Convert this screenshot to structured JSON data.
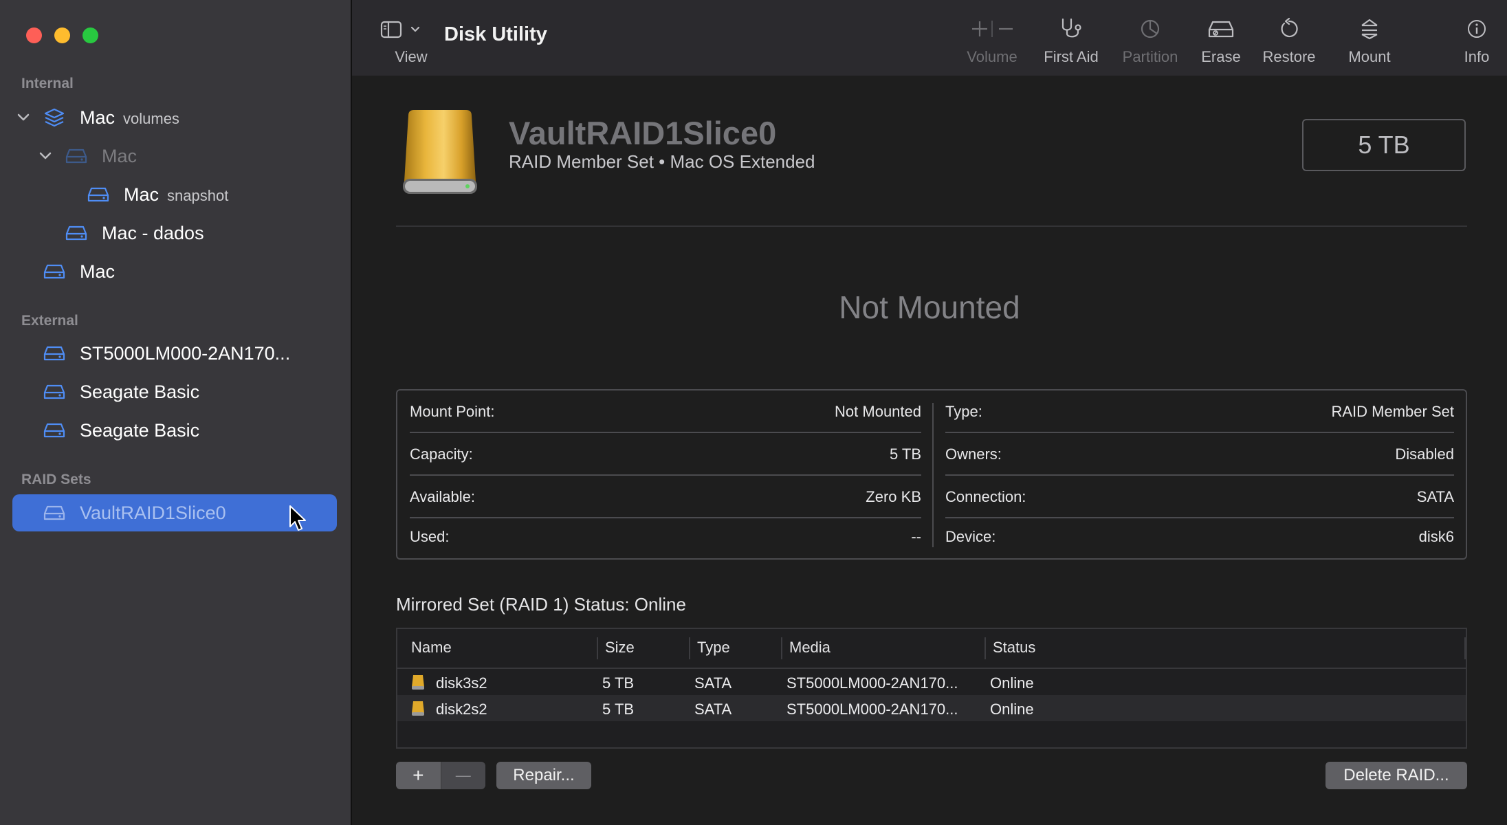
{
  "window": {
    "title": "Disk Utility",
    "view_label": "View"
  },
  "toolbar": {
    "volume_label": "Volume",
    "first_aid_label": "First Aid",
    "partition_label": "Partition",
    "erase_label": "Erase",
    "restore_label": "Restore",
    "mount_label": "Mount",
    "info_label": "Info"
  },
  "sidebar": {
    "internal_header": "Internal",
    "external_header": "External",
    "raid_header": "RAID Sets",
    "items": [
      {
        "label": "Mac",
        "sub": "volumes",
        "icon": "layers-icon",
        "level": 0,
        "expanded": true
      },
      {
        "label": "Mac",
        "sub": "",
        "icon": "disk-icon",
        "level": 1,
        "expanded": true,
        "dimmed": true
      },
      {
        "label": "Mac",
        "sub": "snapshot",
        "icon": "disk-icon",
        "level": 2
      },
      {
        "label": "Mac - dados",
        "sub": "",
        "icon": "disk-icon",
        "level": 1
      },
      {
        "label": "Mac",
        "sub": "",
        "icon": "disk-icon",
        "level": 0
      }
    ],
    "external_items": [
      {
        "label": "ST5000LM000-2AN170...",
        "icon": "disk-icon"
      },
      {
        "label": "Seagate Basic",
        "icon": "disk-icon"
      },
      {
        "label": "Seagate Basic",
        "icon": "disk-icon"
      }
    ],
    "raid_items": [
      {
        "label": "VaultRAID1Slice0",
        "icon": "disk-icon",
        "selected": true
      }
    ]
  },
  "volume": {
    "name": "VaultRAID1Slice0",
    "subtitle": "RAID Member Set • Mac OS Extended",
    "capacity_badge": "5 TB",
    "state_text": "Not Mounted"
  },
  "info": {
    "left": [
      {
        "key": "Mount Point:",
        "value": "Not Mounted"
      },
      {
        "key": "Capacity:",
        "value": "5 TB"
      },
      {
        "key": "Available:",
        "value": "Zero KB"
      },
      {
        "key": "Used:",
        "value": "--"
      }
    ],
    "right": [
      {
        "key": "Type:",
        "value": "RAID Member Set"
      },
      {
        "key": "Owners:",
        "value": "Disabled"
      },
      {
        "key": "Connection:",
        "value": "SATA"
      },
      {
        "key": "Device:",
        "value": "disk6"
      }
    ]
  },
  "raid": {
    "status_title": "Mirrored Set (RAID 1) Status: Online",
    "columns": [
      "Name",
      "Size",
      "Type",
      "Media",
      "Status"
    ],
    "rows": [
      {
        "name": "disk3s2",
        "size": "5 TB",
        "type": "SATA",
        "media": "ST5000LM000-2AN170...",
        "status": "Online"
      },
      {
        "name": "disk2s2",
        "size": "5 TB",
        "type": "SATA",
        "media": "ST5000LM000-2AN170...",
        "status": "Online"
      }
    ],
    "add_label": "+",
    "remove_label": "—",
    "repair_label": "Repair...",
    "delete_label": "Delete RAID..."
  },
  "colors": {
    "accent": "#3f6fd6",
    "disk_gold": "#e0a92a",
    "sidebar_bg": "#38373b",
    "window_bg": "#1e1e1e"
  }
}
